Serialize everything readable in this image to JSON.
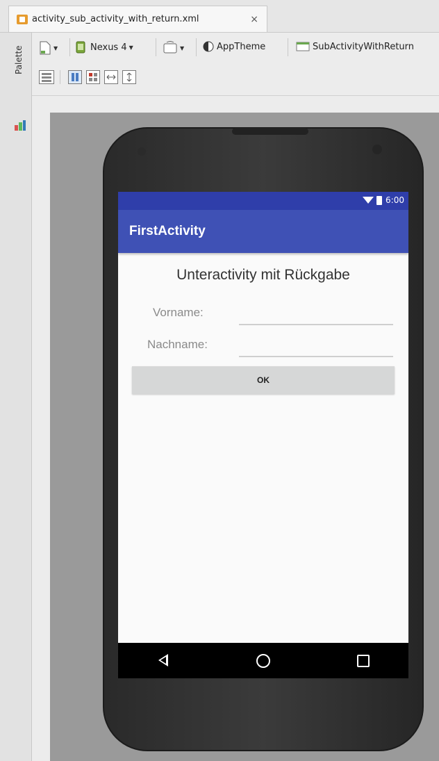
{
  "editor": {
    "tab_label": "activity_sub_activity_with_return.xml",
    "tab_close": "×",
    "palette_label": "Palette"
  },
  "toolbar": {
    "device": "Nexus 4",
    "theme": "AppTheme",
    "activity": "SubActivityWithReturn"
  },
  "phone": {
    "status_time": "6:00",
    "app_title": "FirstActivity",
    "content_title": "Unteractivity mit Rückgabe",
    "form": {
      "first_name_label": "Vorname:",
      "first_name_value": "",
      "last_name_label": "Nachname:",
      "last_name_value": "",
      "ok_label": "OK"
    }
  },
  "colors": {
    "status_bar": "#2f3eaa",
    "app_bar": "#3f51b5",
    "button": "#d6d7d7"
  }
}
